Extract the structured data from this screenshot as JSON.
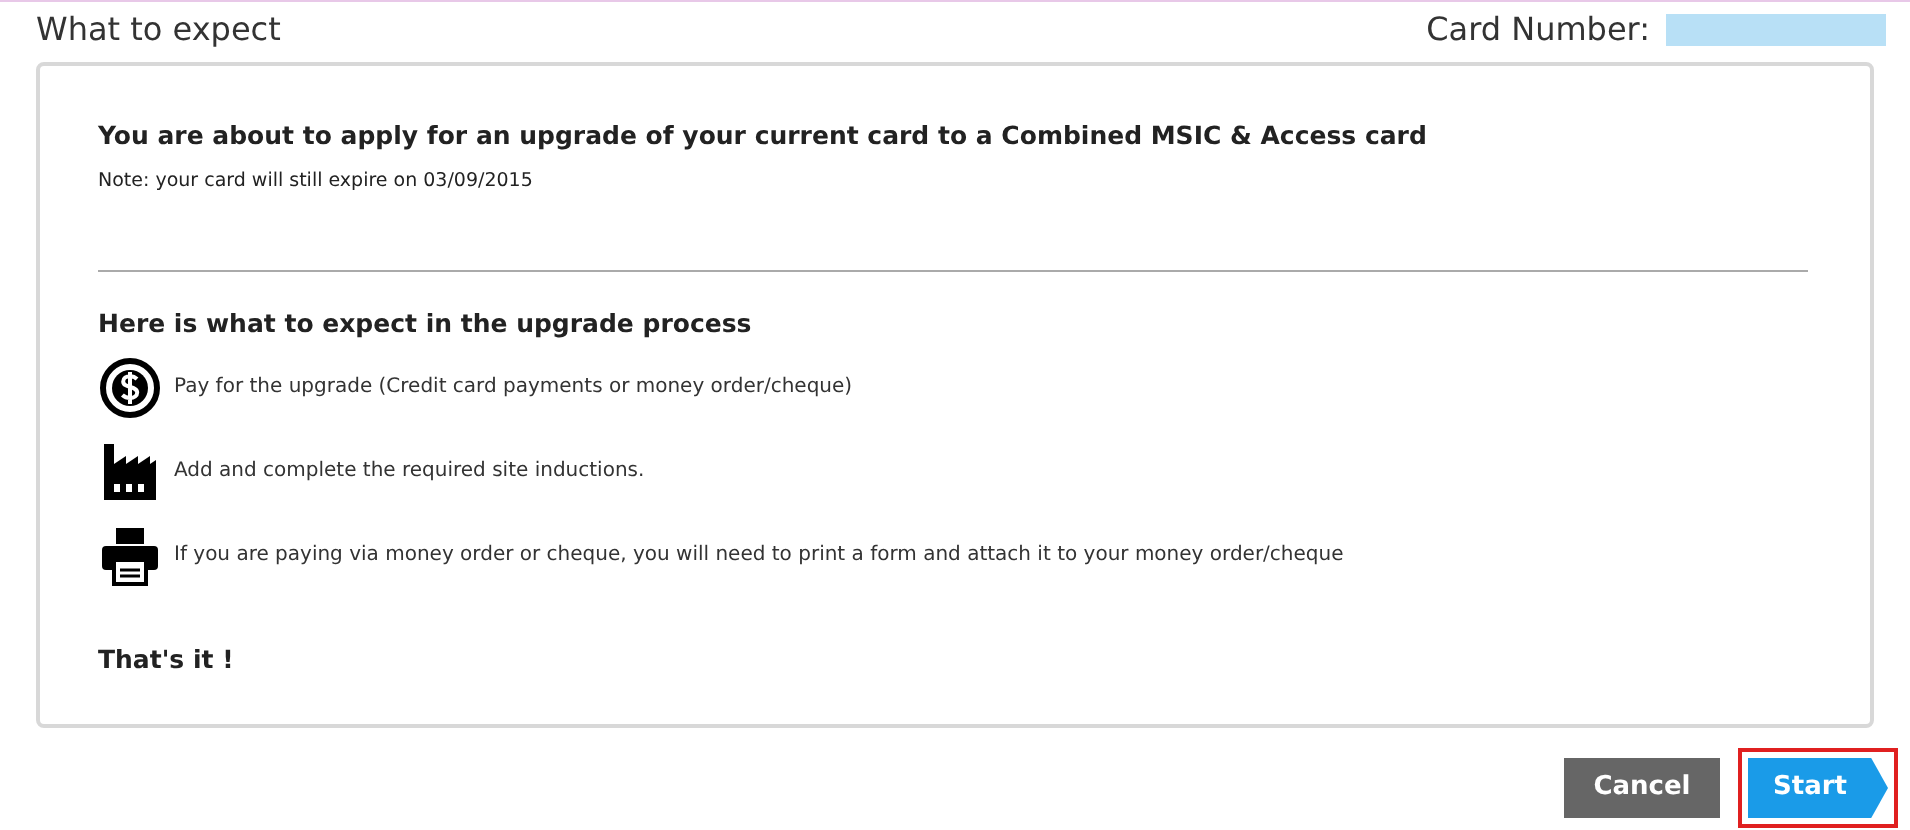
{
  "page_title": "What to expect",
  "card_number_label": "Card Number:",
  "intro": {
    "headline": "You are about to apply for an upgrade of your current card to a Combined MSIC & Access card",
    "note": "Note: your card will still expire on 03/09/2015"
  },
  "process": {
    "heading": "Here is what to expect in the upgrade process",
    "steps": [
      {
        "kind": "payment",
        "text": "Pay for the upgrade (Credit card payments or money order/cheque)"
      },
      {
        "kind": "site",
        "text": "Add and complete the required site inductions."
      },
      {
        "kind": "print",
        "text": "If you are paying via money order or cheque, you will need to print a form and attach it to your money order/cheque"
      }
    ],
    "closing": "That's it !"
  },
  "buttons": [
    {
      "kind": "cancel",
      "label": "Cancel",
      "highlighted": false
    },
    {
      "kind": "start",
      "label": "Start",
      "highlighted": true
    }
  ]
}
